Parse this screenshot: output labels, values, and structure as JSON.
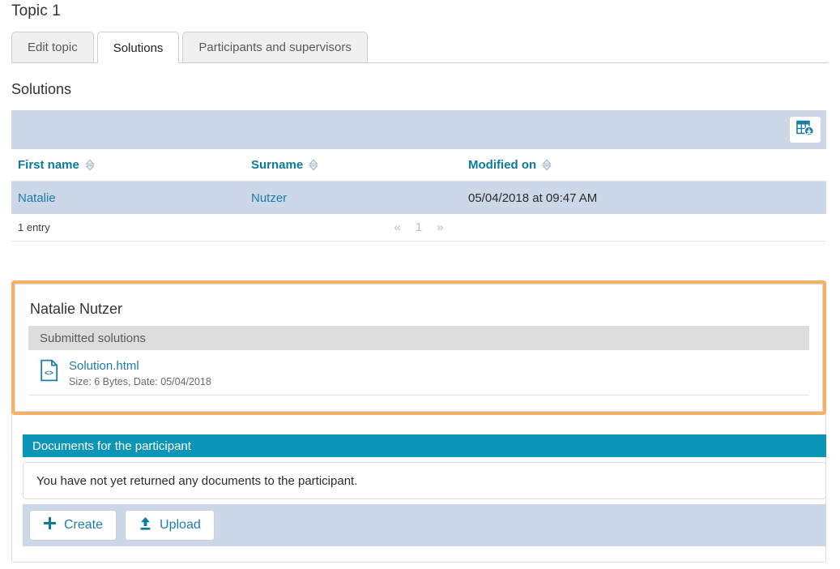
{
  "page_title": "Topic 1",
  "tabs": [
    {
      "label": "Edit topic",
      "active": false
    },
    {
      "label": "Solutions",
      "active": true
    },
    {
      "label": "Participants and supervisors",
      "active": false
    }
  ],
  "section_heading": "Solutions",
  "toolbar": {
    "export_icon": "table-download-icon",
    "export_title": "Export table"
  },
  "table": {
    "columns": [
      "First name",
      "Surname",
      "Modified on"
    ],
    "sort_icon": "sort-updown-icon",
    "rows": [
      {
        "first_name": "Natalie",
        "surname": "Nutzer",
        "modified_on": "05/04/2018 at 09:47 AM"
      }
    ],
    "entry_count": "1 entry",
    "pager": {
      "prev": "«",
      "page": "1",
      "next": "»"
    }
  },
  "solution_panel": {
    "participant": "Natalie Nutzer",
    "subheader": "Submitted solutions",
    "file": {
      "icon": "html-file-icon",
      "name": "Solution.html",
      "meta": "Size: 6 Bytes, Date: 05/04/2018"
    }
  },
  "documents": {
    "header": "Documents for the participant",
    "empty_message": "You have not yet returned any documents to the participant.",
    "buttons": [
      {
        "label": "Create",
        "icon": "plus-icon"
      },
      {
        "label": "Upload",
        "icon": "upload-icon"
      }
    ]
  },
  "colors": {
    "accent_teal": "#0b96b8",
    "link_blue": "#1e7ca8",
    "header_blue": "#0e7a9b",
    "row_blue": "#ccd8e8",
    "highlight_orange": "#f5b166",
    "subheader_gray": "#dddddd"
  }
}
